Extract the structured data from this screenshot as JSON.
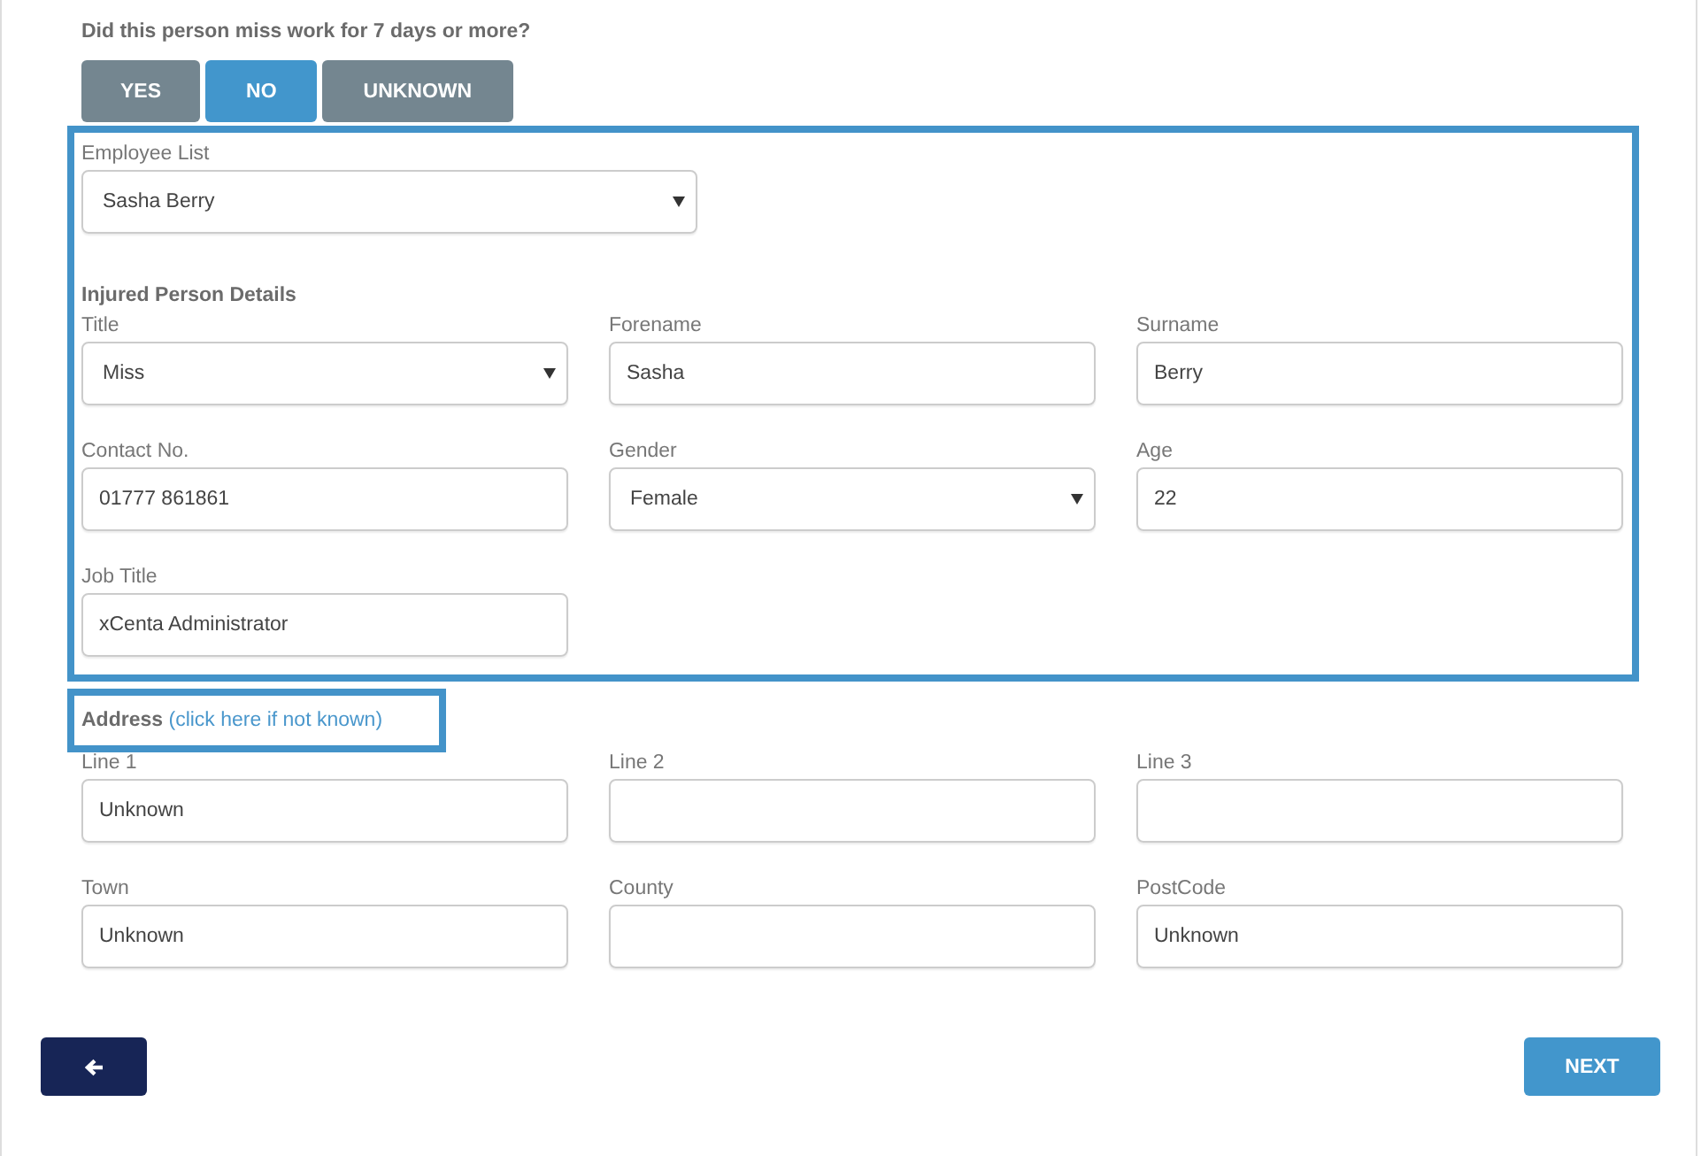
{
  "question": "Did this person miss work for 7 days or more?",
  "answers": [
    {
      "label": "YES",
      "selected": false
    },
    {
      "label": "NO",
      "selected": true
    },
    {
      "label": "UNKNOWN",
      "selected": false
    }
  ],
  "employee_list": {
    "label": "Employee List",
    "value": "Sasha Berry"
  },
  "section_title": "Injured Person Details",
  "person_fields": [
    {
      "label": "Title",
      "value": "Miss",
      "kind": "select"
    },
    {
      "label": "Forename",
      "value": "Sasha",
      "kind": "text"
    },
    {
      "label": "Surname",
      "value": "Berry",
      "kind": "text"
    },
    {
      "label": "Contact No.",
      "value": "01777 861861",
      "kind": "text"
    },
    {
      "label": "Gender",
      "value": "Female",
      "kind": "select"
    },
    {
      "label": "Age",
      "value": "22",
      "kind": "text"
    },
    {
      "label": "Job Title",
      "value": "xCenta Administrator",
      "kind": "text"
    }
  ],
  "address": {
    "title": "Address",
    "link": "(click here if not known)"
  },
  "address_fields": [
    {
      "label": "Line 1",
      "value": "Unknown",
      "kind": "text"
    },
    {
      "label": "Line 2",
      "kind": "text"
    },
    {
      "label": "Line 3",
      "kind": "text"
    },
    {
      "label": "Town",
      "value": "Unknown",
      "kind": "text"
    },
    {
      "label": "County",
      "kind": "text"
    },
    {
      "label": "PostCode",
      "value": "Unknown",
      "kind": "text"
    }
  ],
  "next_button": "NEXT"
}
